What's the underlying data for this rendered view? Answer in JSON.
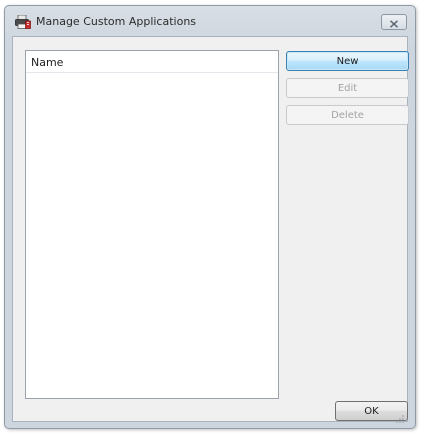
{
  "window": {
    "title": "Manage Custom Applications",
    "icons": {
      "app": "printer-app-icon",
      "close": "close-icon",
      "resize": "resize-grip-icon"
    }
  },
  "list": {
    "columns": [
      "Name"
    ],
    "rows": []
  },
  "buttons": {
    "new": "New",
    "edit": "Edit",
    "delete": "Delete",
    "ok": "OK"
  },
  "colors": {
    "accent_border": "#3c7fb1",
    "disabled_text": "#a3a3a3"
  }
}
